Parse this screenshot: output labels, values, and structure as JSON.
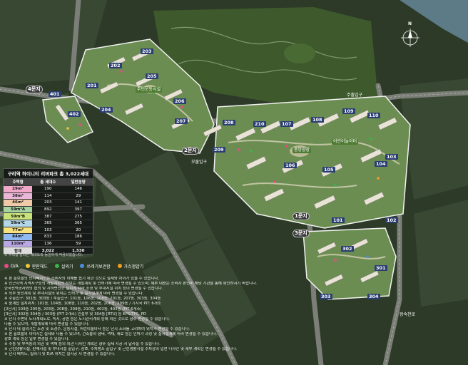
{
  "table": {
    "title": "구리역 하이니티 리버파크 총 3,022세대",
    "headers": [
      "주택형",
      "총 세대수",
      "일반분양"
    ],
    "rows": [
      {
        "type": "29m²",
        "total": "190",
        "general": "146",
        "color": "#f1a9c9"
      },
      {
        "type": "38m²",
        "total": "114",
        "general": "29",
        "color": "#e9b7d8"
      },
      {
        "type": "46m²",
        "total": "203",
        "general": "141",
        "color": "#f0c9a8"
      },
      {
        "type": "59m²A",
        "total": "892",
        "general": "397",
        "color": "#a7d3a1"
      },
      {
        "type": "59m²B",
        "total": "387",
        "general": "275",
        "color": "#c9e37a"
      },
      {
        "type": "59m²C",
        "total": "365",
        "general": "365",
        "color": "#b3d7e8"
      },
      {
        "type": "77m²",
        "total": "103",
        "general": "20",
        "color": "#f7e27c"
      },
      {
        "type": "84m²",
        "total": "833",
        "general": "186",
        "color": "#8fb9f0"
      },
      {
        "type": "110m²",
        "total": "136",
        "general": "59",
        "color": "#b9a7e6"
      },
      {
        "type": "합계",
        "total": "3,022",
        "general": "1,530",
        "color": "#dddddd"
      }
    ],
    "note": "※ 주택형 칼라는 세대도와 동일하게 적용되었습니다."
  },
  "legend": [
    {
      "label": "D/A",
      "color": "#e94b8a",
      "shape": "dot"
    },
    {
      "label": "판판해드",
      "color": "#f0c33c",
      "shape": "dot"
    },
    {
      "label": "실외기",
      "color": "#39b54a",
      "shape": "dot"
    },
    {
      "label": "쓰레기보관함",
      "color": "#4a8ee0",
      "shape": "dot"
    },
    {
      "label": "가스정압기",
      "color": "#f29c1f",
      "shape": "dot"
    }
  ],
  "notes": [
    "※ 본 홍보물의 단지배치도는 소비자의 이해를 돕기 위한 것으로 실제와 차이가 있을 수 있습니다.",
    "※ 인근지역 지역지구등의 개발계획의 정보는 개발계획 및 인허가에 따라 변경될 수 있으며, 세부 내용은 소비자 본인이 해당 기관을 통해 확인하시기 바랍니다.",
    "   한국전력공사와의 협의 및 지하변전소 설치에 따라 조경 및 부대시설 위치 등이 변경될 수 있습니다.",
    "※ 외부 동선계획 및 부대시설의 위치는 인허가 및 실시설계에 따라 변경될 수 있습니다.",
    "※ 주출입구: 301동, 303동 / 부출입구: 101동, 106동, 108동, 201동, 207동, 303동, 304동",
    "※ 중계탑 설치위치: 101동, 104동, 108동, 110동, 202동, 206동, 209동 / 기지국 PIT: 6개소",
    "   [2단지] 103동 205동, 203동, 208동, 209동, 210동, 402동, 403동 (PIT 6개소)",
    "   [3단지] 302동 304동 / 303동 (PIT 2개소) 인접부 및 304동 [RTU] 등 EPS/TPS, PD",
    "※ 단지 주변의 도시계획도로, 녹지, 공원 등은 도시관리계획 등에 의한 것으로 향후 변경될 수 있습니다.",
    "   다를 수 있으며, 개발계획에 따라 변경될 수 있습니다.",
    "※ 단지 내 실외기는 조경 및 조경수, 운동시설, 어린이놀이터 등은 단지 조화를 고려하여 위치가 변경될 수 있습니다.",
    "※ 본 홍보물의 이미지는 실제와 다를 수 있으며, 건축물의 형태, 색채, 재료 등은 인허가 과정 및 실시설계에 따라 변경될 수 있습니다.",
    "   창호 계획 등은 일부 변경될 수 있습니다.",
    "※ 주동 및 부속동의 외관 및 색채 등의 외관 디자인 계획은 향후 실제 시공 시 달라질 수 있습니다.",
    "※ 근린생활시설, 판매시설 및 부대시설 출입구, 창호, 주차램프 출입구 및 근린생활시설 주차장의 입면 디자인 및 세부 계획은 변경될 수 있습니다.",
    "※ 단지 배치도, 실외기 및 D/A 위치는 실시공 시 변경될 수 있습니다."
  ],
  "buildings": [
    "101",
    "102",
    "103",
    "104",
    "105",
    "106",
    "107",
    "108",
    "109",
    "110",
    "201",
    "202",
    "203",
    "204",
    "205",
    "206",
    "207",
    "208",
    "209",
    "210",
    "301",
    "302",
    "303",
    "304",
    "401",
    "402"
  ],
  "gates": [
    "1문지",
    "2문지",
    "3문지",
    "4문지"
  ],
  "labels": {
    "main_gate": "주출입구",
    "sub_gate": "부출입구",
    "zone_park": "중앙광장",
    "zone_garden": "어린이놀이터",
    "zone_play": "주민운동시설",
    "road_east": "왕숙천로",
    "north": "N"
  }
}
